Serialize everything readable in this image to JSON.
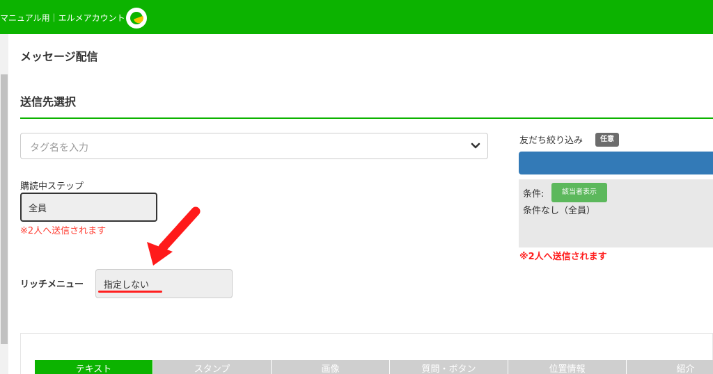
{
  "header": {
    "account_name": "マニュアル用｜エルメアカウント",
    "logo_icon": "lme-logo-icon",
    "color": "#0cb300"
  },
  "page": {
    "title": "メッセージ配信"
  },
  "recipient": {
    "section_title": "送信先選択",
    "tag_placeholder": "タグ名を入力",
    "step_label": "購読中ステップ",
    "step_value": "全員",
    "send_note": "※2人へ送信されます"
  },
  "rich_menu": {
    "label": "リッチメニュー",
    "value": "指定しない"
  },
  "friend_filter": {
    "label": "友だち絞り込み",
    "badge": "任意",
    "condition_label": "条件:",
    "show_matched_button": "該当者表示",
    "condition_text": "条件なし（全員）",
    "send_note": "※2人へ送信されます"
  },
  "message_tabs": [
    {
      "label": "テキスト",
      "active": true
    },
    {
      "label": "スタンプ",
      "active": false
    },
    {
      "label": "画像",
      "active": false
    },
    {
      "label": "質問・ボタン",
      "active": false
    },
    {
      "label": "位置情報",
      "active": false
    },
    {
      "label": "紹介",
      "active": false
    }
  ],
  "colors": {
    "brand_green": "#0cb300",
    "alert_red": "#ff1f1f",
    "button_blue": "#337ab7",
    "button_green": "#5cb85c"
  }
}
